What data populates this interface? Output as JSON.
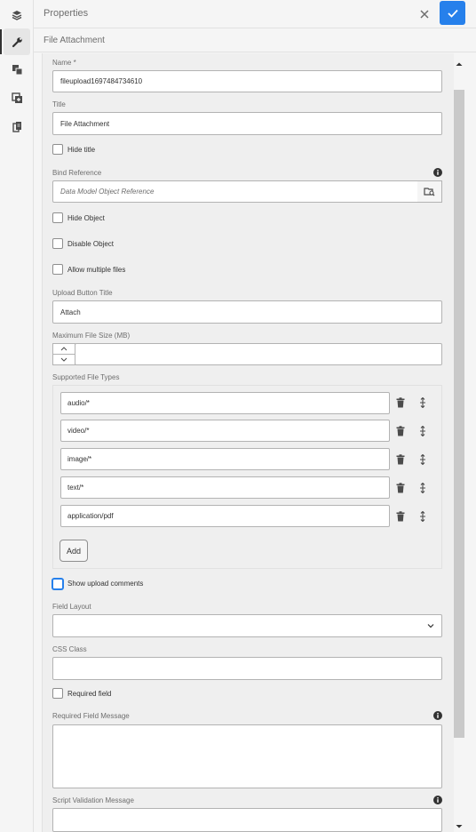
{
  "header": {
    "title": "Properties"
  },
  "component": {
    "title": "File Attachment"
  },
  "form": {
    "name": {
      "label": "Name *",
      "value": "fileupload1697484734610"
    },
    "title": {
      "label": "Title",
      "value": "File Attachment"
    },
    "hide_title": {
      "label": "Hide title",
      "checked": false
    },
    "bind_reference": {
      "label": "Bind Reference",
      "placeholder": "Data Model Object Reference"
    },
    "hide_object": {
      "label": "Hide Object",
      "checked": false
    },
    "disable_object": {
      "label": "Disable Object",
      "checked": false
    },
    "allow_multiple": {
      "label": "Allow multiple files",
      "checked": false
    },
    "upload_button_title": {
      "label": "Upload Button Title",
      "value": "Attach"
    },
    "max_file_size": {
      "label": "Maximum File Size (MB)",
      "value": ""
    },
    "supported_types": {
      "label": "Supported File Types",
      "items": [
        "audio/*",
        "video/*",
        "image/*",
        "text/*",
        "application/pdf"
      ],
      "add_label": "Add"
    },
    "show_upload_comments": {
      "label": "Show upload comments",
      "checked": false
    },
    "field_layout": {
      "label": "Field Layout",
      "value": ""
    },
    "css_class": {
      "label": "CSS Class",
      "value": ""
    },
    "required_field": {
      "label": "Required field",
      "checked": false
    },
    "required_message": {
      "label": "Required Field Message",
      "value": ""
    },
    "script_validation_message": {
      "label": "Script Validation Message",
      "value": ""
    }
  },
  "rail": {
    "icons": [
      "layers-icon",
      "wrench-icon",
      "components-icon",
      "add-asset-icon",
      "clipboard-icon"
    ]
  },
  "colors": {
    "accent": "#2680eb",
    "panel": "#efefef"
  }
}
